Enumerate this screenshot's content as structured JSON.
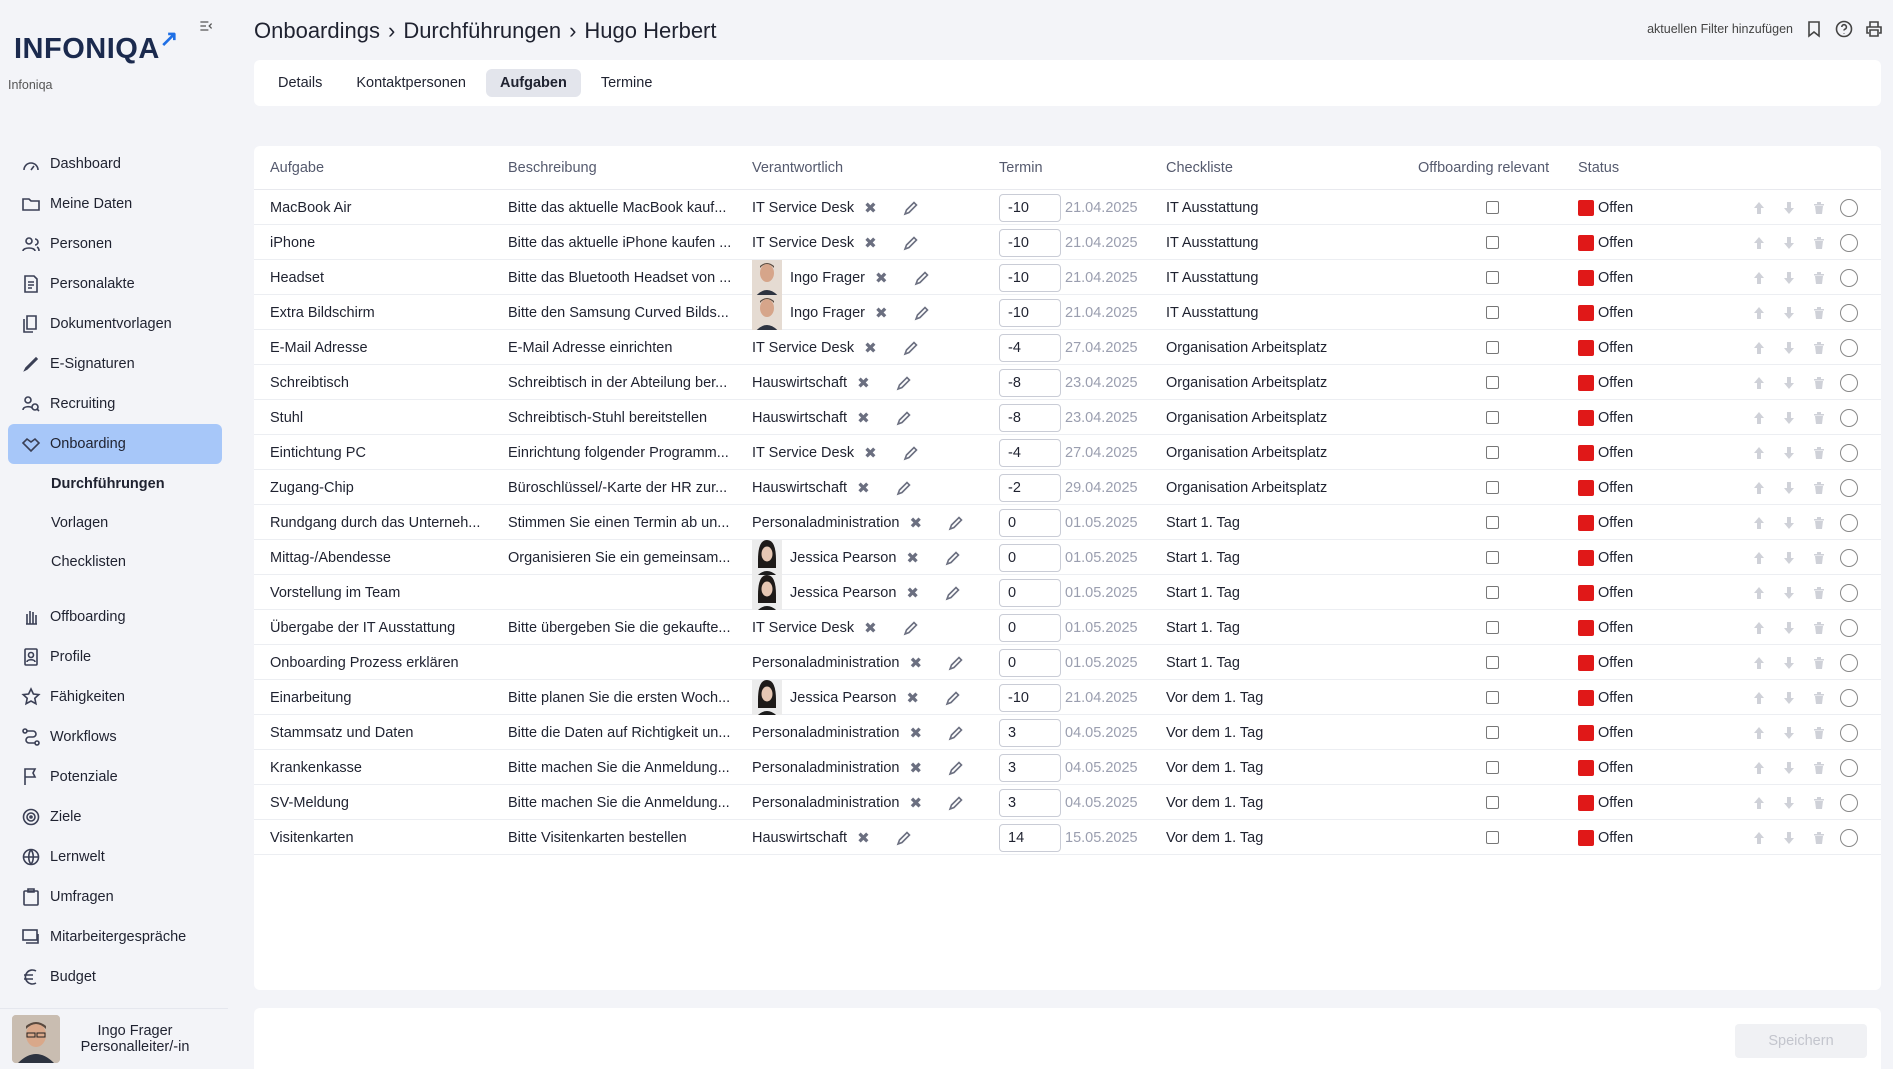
{
  "brand": {
    "logo": "INFONIQA",
    "logo_arrow": "↗",
    "tenant": "Infoniqa"
  },
  "sidebar": {
    "items_top": [
      {
        "label": "Dashboard",
        "icon": "dashboard-icon"
      },
      {
        "label": "Meine Daten",
        "icon": "folder-icon"
      },
      {
        "label": "Personen",
        "icon": "people-icon"
      },
      {
        "label": "Personalakte",
        "icon": "file-icon"
      },
      {
        "label": "Dokumentvorlagen",
        "icon": "document-template-icon"
      },
      {
        "label": "E-Signaturen",
        "icon": "pen-icon"
      },
      {
        "label": "Recruiting",
        "icon": "recruiting-icon"
      },
      {
        "label": "Onboarding",
        "icon": "handshake-icon",
        "active": true
      }
    ],
    "sub_items": [
      {
        "label": "Durchführungen",
        "active": true
      },
      {
        "label": "Vorlagen"
      },
      {
        "label": "Checklisten"
      }
    ],
    "items_bottom": [
      {
        "label": "Offboarding",
        "icon": "hand-icon"
      },
      {
        "label": "Profile",
        "icon": "profile-icon"
      },
      {
        "label": "Fähigkeiten",
        "icon": "star-icon"
      },
      {
        "label": "Workflows",
        "icon": "workflow-icon"
      },
      {
        "label": "Potenziale",
        "icon": "flag-icon"
      },
      {
        "label": "Ziele",
        "icon": "target-icon"
      },
      {
        "label": "Lernwelt",
        "icon": "learning-icon"
      },
      {
        "label": "Umfragen",
        "icon": "survey-icon"
      },
      {
        "label": "Mitarbeitergespräche",
        "icon": "conversation-icon"
      },
      {
        "label": "Budget",
        "icon": "euro-icon"
      }
    ]
  },
  "user": {
    "name": "Ingo Frager",
    "role": "Personalleiter/-in"
  },
  "header": {
    "breadcrumb": [
      "Onboardings",
      "›",
      "Durchführungen",
      "›",
      "Hugo Herbert"
    ],
    "filter_label": "aktuellen Filter hinzufügen"
  },
  "tabs": [
    {
      "label": "Details"
    },
    {
      "label": "Kontaktpersonen"
    },
    {
      "label": "Aufgaben",
      "active": true
    },
    {
      "label": "Termine"
    }
  ],
  "table": {
    "columns": [
      "Aufgabe",
      "Beschreibung",
      "Verantwortlich",
      "Termin",
      "Checkliste",
      "Offboarding relevant",
      "Status"
    ],
    "rows": [
      {
        "aufgabe": "MacBook Air",
        "beschreibung": "Bitte das aktuelle MacBook kauf...",
        "verantwortlich": "IT Service Desk",
        "photo": "",
        "offset": "-10",
        "datum": "21.04.2025",
        "checkliste": "IT Ausstattung",
        "status": "Offen"
      },
      {
        "aufgabe": "iPhone",
        "beschreibung": "Bitte das aktuelle iPhone kaufen ...",
        "verantwortlich": "IT Service Desk",
        "photo": "",
        "offset": "-10",
        "datum": "21.04.2025",
        "checkliste": "IT Ausstattung",
        "status": "Offen"
      },
      {
        "aufgabe": "Headset",
        "beschreibung": "Bitte das Bluetooth Headset von ...",
        "verantwortlich": "Ingo Frager",
        "photo": "m",
        "offset": "-10",
        "datum": "21.04.2025",
        "checkliste": "IT Ausstattung",
        "status": "Offen"
      },
      {
        "aufgabe": "Extra Bildschirm",
        "beschreibung": "Bitte den Samsung Curved Bilds...",
        "verantwortlich": "Ingo Frager",
        "photo": "m",
        "offset": "-10",
        "datum": "21.04.2025",
        "checkliste": "IT Ausstattung",
        "status": "Offen"
      },
      {
        "aufgabe": "E-Mail Adresse",
        "beschreibung": "E-Mail Adresse einrichten",
        "verantwortlich": "IT Service Desk",
        "photo": "",
        "offset": "-4",
        "datum": "27.04.2025",
        "checkliste": "Organisation Arbeitsplatz",
        "status": "Offen"
      },
      {
        "aufgabe": "Schreibtisch",
        "beschreibung": "Schreibtisch in der Abteilung ber...",
        "verantwortlich": "Hauswirtschaft",
        "photo": "",
        "offset": "-8",
        "datum": "23.04.2025",
        "checkliste": "Organisation Arbeitsplatz",
        "status": "Offen"
      },
      {
        "aufgabe": "Stuhl",
        "beschreibung": "Schreibtisch-Stuhl bereitstellen",
        "verantwortlich": "Hauswirtschaft",
        "photo": "",
        "offset": "-8",
        "datum": "23.04.2025",
        "checkliste": "Organisation Arbeitsplatz",
        "status": "Offen"
      },
      {
        "aufgabe": "Eintichtung PC",
        "beschreibung": "Einrichtung folgender Programm...",
        "verantwortlich": "IT Service Desk",
        "photo": "",
        "offset": "-4",
        "datum": "27.04.2025",
        "checkliste": "Organisation Arbeitsplatz",
        "status": "Offen"
      },
      {
        "aufgabe": "Zugang-Chip",
        "beschreibung": "Büroschlüssel/-Karte der HR zur...",
        "verantwortlich": "Hauswirtschaft",
        "photo": "",
        "offset": "-2",
        "datum": "29.04.2025",
        "checkliste": "Organisation Arbeitsplatz",
        "status": "Offen"
      },
      {
        "aufgabe": "Rundgang durch das Unterneh...",
        "beschreibung": "Stimmen Sie einen Termin ab un...",
        "verantwortlich": "Personaladministration",
        "photo": "",
        "offset": "0",
        "datum": "01.05.2025",
        "checkliste": "Start 1. Tag",
        "status": "Offen"
      },
      {
        "aufgabe": "Mittag-/Abendesse",
        "beschreibung": "Organisieren Sie ein gemeinsam...",
        "verantwortlich": "Jessica Pearson",
        "photo": "f",
        "offset": "0",
        "datum": "01.05.2025",
        "checkliste": "Start 1. Tag",
        "status": "Offen"
      },
      {
        "aufgabe": "Vorstellung im Team",
        "beschreibung": "",
        "verantwortlich": "Jessica Pearson",
        "photo": "f",
        "offset": "0",
        "datum": "01.05.2025",
        "checkliste": "Start 1. Tag",
        "status": "Offen"
      },
      {
        "aufgabe": "Übergabe der IT Ausstattung",
        "beschreibung": "Bitte übergeben Sie die gekaufte...",
        "verantwortlich": "IT Service Desk",
        "photo": "",
        "offset": "0",
        "datum": "01.05.2025",
        "checkliste": "Start 1. Tag",
        "status": "Offen"
      },
      {
        "aufgabe": "Onboarding Prozess erklären",
        "beschreibung": "",
        "verantwortlich": "Personaladministration",
        "photo": "",
        "offset": "0",
        "datum": "01.05.2025",
        "checkliste": "Start 1. Tag",
        "status": "Offen"
      },
      {
        "aufgabe": "Einarbeitung",
        "beschreibung": "Bitte planen Sie die ersten Woch...",
        "verantwortlich": "Jessica Pearson",
        "photo": "f",
        "offset": "-10",
        "datum": "21.04.2025",
        "checkliste": "Vor dem 1. Tag",
        "status": "Offen"
      },
      {
        "aufgabe": "Stammsatz und Daten",
        "beschreibung": "Bitte die Daten auf Richtigkeit un...",
        "verantwortlich": "Personaladministration",
        "photo": "",
        "offset": "3",
        "datum": "04.05.2025",
        "checkliste": "Vor dem 1. Tag",
        "status": "Offen"
      },
      {
        "aufgabe": "Krankenkasse",
        "beschreibung": "Bitte machen Sie die Anmeldung...",
        "verantwortlich": "Personaladministration",
        "photo": "",
        "offset": "3",
        "datum": "04.05.2025",
        "checkliste": "Vor dem 1. Tag",
        "status": "Offen"
      },
      {
        "aufgabe": "SV-Meldung",
        "beschreibung": "Bitte machen Sie die Anmeldung...",
        "verantwortlich": "Personaladministration",
        "photo": "",
        "offset": "3",
        "datum": "04.05.2025",
        "checkliste": "Vor dem 1. Tag",
        "status": "Offen"
      },
      {
        "aufgabe": "Visitenkarten",
        "beschreibung": "Bitte Visitenkarten bestellen",
        "verantwortlich": "Hauswirtschaft",
        "photo": "",
        "offset": "14",
        "datum": "15.05.2025",
        "checkliste": "Vor dem 1. Tag",
        "status": "Offen"
      }
    ]
  },
  "colors": {
    "status_open": "#e01818",
    "active_nav": "#a7c7f9",
    "brand_arrow": "#1f6fe5"
  },
  "footer": {
    "save_label": "Speichern"
  }
}
